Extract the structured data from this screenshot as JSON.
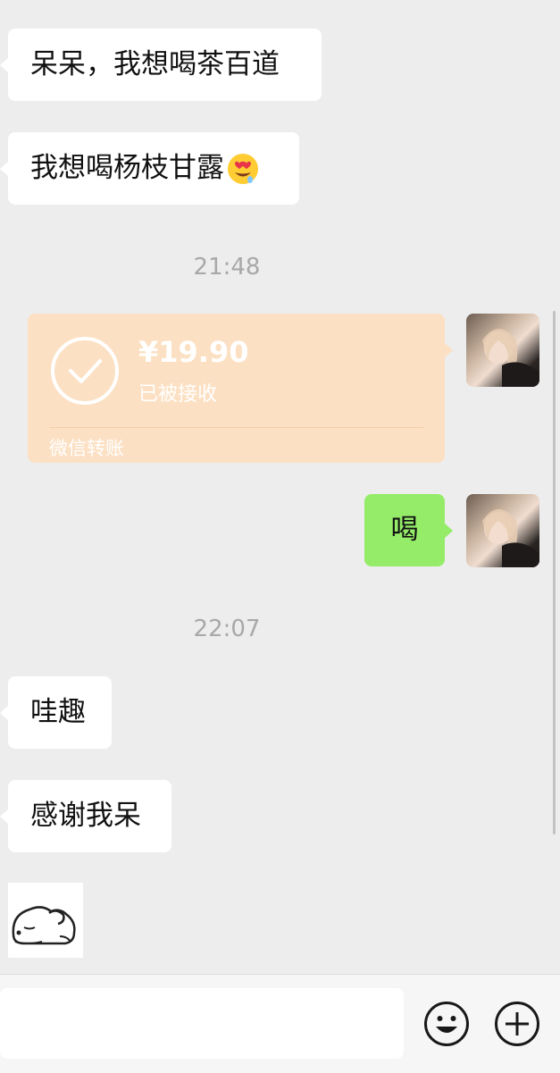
{
  "messages": {
    "m1": "呆呆，我想喝茶百道",
    "m2": "我想喝杨枝甘露",
    "time1": "21:48",
    "transfer": {
      "amount": "¥19.90",
      "status": "已被接收",
      "footer": "微信转账"
    },
    "m3": "喝",
    "time2": "22:07",
    "m4": "哇趣",
    "m5": "感谢我呆"
  },
  "input": {
    "placeholder": ""
  },
  "icons": {
    "emoji_in_message": "heart-eyes-emoji",
    "check": "check-circle-icon",
    "sticker": "sleeping-puppy-sticker",
    "emoji_button": "smile-icon",
    "add_button": "plus-circle-icon"
  },
  "colors": {
    "background": "#ededed",
    "sent_bubble": "#95ec69",
    "received_bubble": "#ffffff",
    "transfer_card": "#fce0c3"
  }
}
